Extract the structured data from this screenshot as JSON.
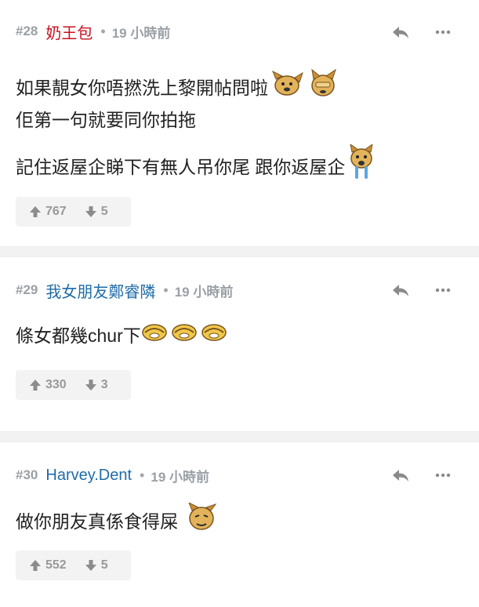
{
  "posts": [
    {
      "number": "#28",
      "username": "奶王包",
      "time": "19 小時前",
      "lines": [
        "如果靚女你唔撚洗上黎開帖問啦",
        "佢第一句就要同你拍拖",
        "記住返屋企睇下有無人吊你尾 跟你返屋企"
      ],
      "upvotes": "767",
      "downvotes": "5"
    },
    {
      "number": "#29",
      "username": "我女朋友鄭睿隣",
      "time": "19 小時前",
      "lines": [
        "條女都幾chur下"
      ],
      "upvotes": "330",
      "downvotes": "3"
    },
    {
      "number": "#30",
      "username": "Harvey.Dent",
      "time": "19 小時前",
      "lines": [
        "做你朋友真係食得屎"
      ],
      "upvotes": "552",
      "downvotes": "5"
    }
  ],
  "colors": {
    "username_red": "#c8101e",
    "username_blue": "#1f6ca8",
    "meta_gray": "#9aa0a6",
    "vote_bg": "#f3f3f3"
  },
  "icons": {
    "reply": "reply-icon",
    "more": "more-icon",
    "upvote": "arrow-up-icon",
    "downvote": "arrow-down-icon",
    "emoji": "dog-emoticon-icon"
  }
}
